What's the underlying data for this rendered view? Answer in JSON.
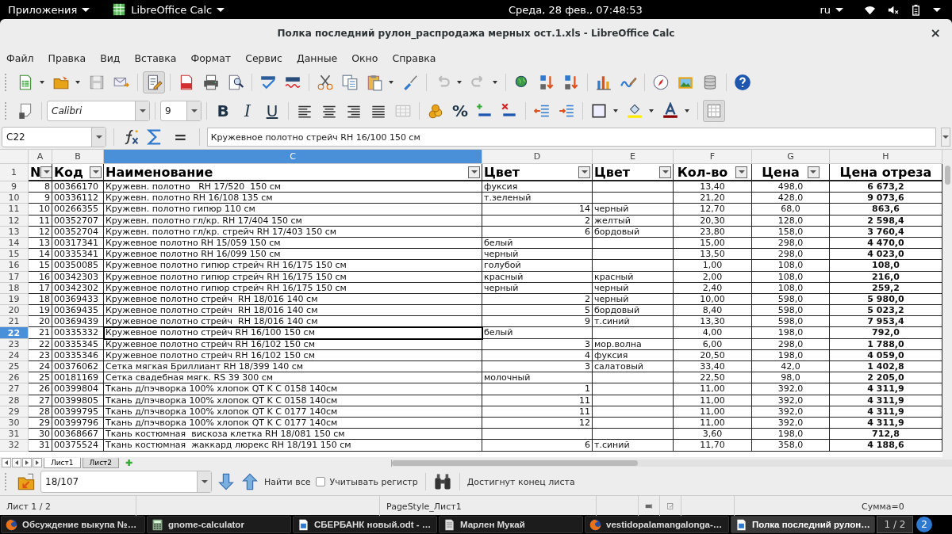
{
  "top_bar": {
    "apps_menu": "Приложения",
    "active_app": "LibreOffice Calc",
    "clock": "Среда, 28 фев., 07:48:53",
    "keyboard_layout": "ru"
  },
  "window": {
    "title": "Полка последний рулон_распродажа мерных ост.1.xls - LibreOffice Calc",
    "close": "×"
  },
  "menu": [
    "Файл",
    "Правка",
    "Вид",
    "Вставка",
    "Формат",
    "Сервис",
    "Данные",
    "Окно",
    "Справка"
  ],
  "standard_toolbar": {
    "edit_mode_on": true
  },
  "formatting_toolbar": {
    "font_name": "Calibri",
    "font_size": "9",
    "style_buttons": [
      {
        "label": "B",
        "kind": "bold"
      },
      {
        "label": "I",
        "kind": "italic"
      },
      {
        "label": "U",
        "kind": "underline"
      }
    ],
    "percent": "%",
    "grid_on": true
  },
  "formula_bar": {
    "cell_ref": "C22",
    "sum_sign": "=",
    "content": "Кружевное полотно стрейч RH 16/100 150 см"
  },
  "sheet": {
    "columns": [
      {
        "label": "A",
        "selected": false
      },
      {
        "label": "B",
        "selected": false
      },
      {
        "label": "C",
        "selected": true
      },
      {
        "label": "D",
        "selected": false
      },
      {
        "label": "E",
        "selected": false
      },
      {
        "label": "F",
        "selected": false
      },
      {
        "label": "G",
        "selected": false
      },
      {
        "label": "H",
        "selected": false
      }
    ],
    "header_row": {
      "row": "1",
      "cells": [
        {
          "text": "N",
          "filter": true
        },
        {
          "text": "Код",
          "filter": true
        },
        {
          "text": "Наименование",
          "filter": true
        },
        {
          "text": "Цвет",
          "filter": true
        },
        {
          "text": "Цвет",
          "filter": true
        },
        {
          "text": "Кол-во",
          "filter": true
        },
        {
          "text": "Цена",
          "filter": true
        },
        {
          "text": "Цена отреза",
          "filter": false
        }
      ]
    },
    "rows": [
      {
        "row": "9",
        "selected": false,
        "n": "8",
        "code": "00366170",
        "name": "Кружевн. полотно   RH 17/520  150 см",
        "d_text": "фуксия",
        "qty": "13,40",
        "price": "498,0",
        "total": "6 673,2"
      },
      {
        "row": "10",
        "selected": false,
        "n": "9",
        "code": "00336112",
        "name": "Кружевн. полотно RH 16/108 135 см",
        "d_text": "т.зеленый",
        "qty": "21,20",
        "price": "428,0",
        "total": "9 073,6"
      },
      {
        "row": "11",
        "selected": false,
        "n": "10",
        "code": "00266355",
        "name": "Кружевн. полотно гипюр 110 см",
        "d_number": "14",
        "e_text": "черный",
        "qty": "12,70",
        "price": "68,0",
        "total": "863,6"
      },
      {
        "row": "12",
        "selected": false,
        "n": "11",
        "code": "00352707",
        "name": "Кружевн. полотно гл/кр. RH 17/404 150 см",
        "d_number": "2",
        "e_text": "желтый",
        "qty": "20,30",
        "price": "128,0",
        "total": "2 598,4"
      },
      {
        "row": "13",
        "selected": false,
        "n": "12",
        "code": "00352704",
        "name": "Кружевн. полотно гл/кр. стрейч RH 17/403 150 см",
        "d_number": "6",
        "e_text": "бордовый",
        "qty": "23,80",
        "price": "158,0",
        "total": "3 760,4"
      },
      {
        "row": "14",
        "selected": false,
        "n": "13",
        "code": "00317341",
        "name": "Кружевное полотно RH 15/059 150 см",
        "d_text": "белый",
        "qty": "15,00",
        "price": "298,0",
        "total": "4 470,0"
      },
      {
        "row": "15",
        "selected": false,
        "n": "14",
        "code": "00335341",
        "name": "Кружевное полотно RH 16/099 150 см",
        "d_text": "черный",
        "qty": "13,50",
        "price": "298,0",
        "total": "4 023,0"
      },
      {
        "row": "16",
        "selected": false,
        "n": "15",
        "code": "00350085",
        "name": "Кружевное полотно гипюр стрейч RH 16/175 150 см",
        "d_text": "голубой",
        "qty": "1,00",
        "price": "108,0",
        "total": "108,0"
      },
      {
        "row": "17",
        "selected": false,
        "n": "16",
        "code": "00342303",
        "name": "Кружевное полотно гипюр стрейч RH 16/175 150 см",
        "d_text": "красный",
        "e_text": "красный",
        "qty": "2,00",
        "price": "108,0",
        "total": "216,0"
      },
      {
        "row": "18",
        "selected": false,
        "n": "17",
        "code": "00342302",
        "name": "Кружевное полотно гипюр стрейч RH 16/175 150 см",
        "d_text": "черный",
        "e_text": "черный",
        "qty": "2,40",
        "price": "108,0",
        "total": "259,2"
      },
      {
        "row": "19",
        "selected": false,
        "n": "18",
        "code": "00369433",
        "name": "Кружевное полотно стрейч  RH 18/016 140 см",
        "d_number": "2",
        "e_text": "черный",
        "qty": "10,00",
        "price": "598,0",
        "total": "5 980,0"
      },
      {
        "row": "20",
        "selected": false,
        "n": "19",
        "code": "00369435",
        "name": "Кружевное полотно стрейч  RH 18/016 140 см",
        "d_number": "5",
        "e_text": "бордовый",
        "qty": "8,40",
        "price": "598,0",
        "total": "5 023,2"
      },
      {
        "row": "21",
        "selected": false,
        "n": "20",
        "code": "00369439",
        "name": "Кружевное полотно стрейч  RH 18/016 140 см",
        "d_number": "9",
        "e_text": "т.синий",
        "qty": "13,30",
        "price": "598,0",
        "total": "7 953,4"
      },
      {
        "row": "22",
        "selected": true,
        "n": "21",
        "code": "00335332",
        "name": "Кружевное полотно стрейч RH 16/100 150 см",
        "d_text": "белый",
        "qty": "4,00",
        "price": "198,0",
        "total": "792,0"
      },
      {
        "row": "23",
        "selected": false,
        "n": "22",
        "code": "00335345",
        "name": "Кружевное полотно стрейч RH 16/102 150 см",
        "d_number": "3",
        "e_text": "мор.волна",
        "qty": "6,00",
        "price": "298,0",
        "total": "1 788,0"
      },
      {
        "row": "24",
        "selected": false,
        "n": "23",
        "code": "00335346",
        "name": "Кружевное полотно стрейч RH 16/102 150 см",
        "d_number": "4",
        "e_text": "фуксия",
        "qty": "20,50",
        "price": "198,0",
        "total": "4 059,0"
      },
      {
        "row": "25",
        "selected": false,
        "n": "24",
        "code": "00376062",
        "name": "Сетка мягкая Бриллиант RH 18/399 140 см",
        "d_number": "3",
        "e_text": "салатовый",
        "qty": "33,40",
        "price": "42,0",
        "total": "1 402,8"
      },
      {
        "row": "26",
        "selected": false,
        "n": "25",
        "code": "00181169",
        "name": "Сетка свадебная мягк. RS 39 300 см",
        "d_text": "молочный",
        "qty": "22,50",
        "price": "98,0",
        "total": "2 205,0"
      },
      {
        "row": "27",
        "selected": false,
        "n": "26",
        "code": "00399804",
        "name": "Ткань д/пэчворка 100% хлопок QT K C 0158 140см",
        "d_number": "1",
        "qty": "11,00",
        "price": "392,0",
        "total": "4 311,9"
      },
      {
        "row": "28",
        "selected": false,
        "n": "27",
        "code": "00399805",
        "name": "Ткань д/пэчворка 100% хлопок QT K C 0158 140см",
        "d_number": "11",
        "qty": "11,00",
        "price": "392,0",
        "total": "4 311,9"
      },
      {
        "row": "29",
        "selected": false,
        "n": "28",
        "code": "00399795",
        "name": "Ткань д/пэчворка 100% хлопок QT K C 0177 140см",
        "d_number": "11",
        "qty": "11,00",
        "price": "392,0",
        "total": "4 311,9"
      },
      {
        "row": "30",
        "selected": false,
        "n": "29",
        "code": "00399796",
        "name": "Ткань д/пэчворка 100% хлопок QT K C 0177 140см",
        "d_number": "12",
        "qty": "11,00",
        "price": "392,0",
        "total": "4 311,9"
      },
      {
        "row": "31",
        "selected": false,
        "n": "30",
        "code": "00368667",
        "name": "Ткань костюмная  вискоза клетка RH 18/081 150 см",
        "qty": "3,60",
        "price": "198,0",
        "total": "712,8"
      },
      {
        "row": "32",
        "selected": false,
        "n": "31",
        "code": "00375524",
        "name": "Ткань костюмная  жаккард люрекс RH 18/191 150 см",
        "d_number": "6",
        "e_text": "т.синий",
        "qty": "11,70",
        "price": "358,0",
        "total": "4 188,6"
      }
    ]
  },
  "sheet_tabs": [
    {
      "label": "Лист1",
      "selected": true
    },
    {
      "label": "Лист2",
      "selected": false
    }
  ],
  "find_bar": {
    "value": "18/107",
    "find_all": "Найти все",
    "match_case": {
      "label": "Учитывать регистр",
      "checked": false
    },
    "message": "Достигнут конец листа"
  },
  "status_bar": {
    "sheet": "Лист 1 / 2",
    "page_style": "PageStyle_Лист1",
    "sum": "Сумма=0"
  },
  "taskbar": {
    "items": [
      {
        "label": "Обсуждение выкупа №…",
        "kind": "browser",
        "selected": false
      },
      {
        "label": "gnome-calculator",
        "kind": "calculator",
        "selected": false
      },
      {
        "label": "СБЕРБАНК новый.odt - …",
        "kind": "writer",
        "selected": false
      },
      {
        "label": "Марлен Мукай",
        "kind": "document",
        "selected": false
      },
      {
        "label": "vestidopalamangalonga-…",
        "kind": "browser",
        "selected": false
      },
      {
        "label": "Полка последний рулон…",
        "kind": "writer",
        "selected": true
      }
    ],
    "workspace": "1 / 2",
    "notifications": "2"
  }
}
